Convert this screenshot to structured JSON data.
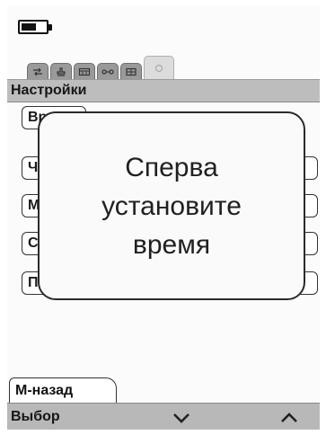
{
  "status": {
    "battery_icon": "battery-icon"
  },
  "tabs": [
    {
      "icon": "arrows-icon"
    },
    {
      "icon": "stamp-icon"
    },
    {
      "icon": "calendar-icon"
    },
    {
      "icon": "link-icon"
    },
    {
      "icon": "grid-icon"
    },
    {
      "icon": "settings-circle-icon",
      "active": true
    }
  ],
  "header": {
    "title": "Настройки"
  },
  "menu": {
    "items": [
      {
        "label": "Вр"
      },
      {
        "label": "Ча"
      },
      {
        "label": "М"
      },
      {
        "label": "Со"
      },
      {
        "label": "По"
      }
    ]
  },
  "dialog": {
    "lines": [
      "Сперва",
      "установите",
      "время"
    ]
  },
  "footer": {
    "back_label": "М-назад",
    "select_label": "Выбор",
    "down_icon": "chevron-down-icon",
    "up_icon": "chevron-up-icon"
  },
  "colors": {
    "title_bar": "#bdbdbd",
    "bottom_bar": "#b8b8b8",
    "tab": "#9a9a9a",
    "border": "#333333"
  }
}
